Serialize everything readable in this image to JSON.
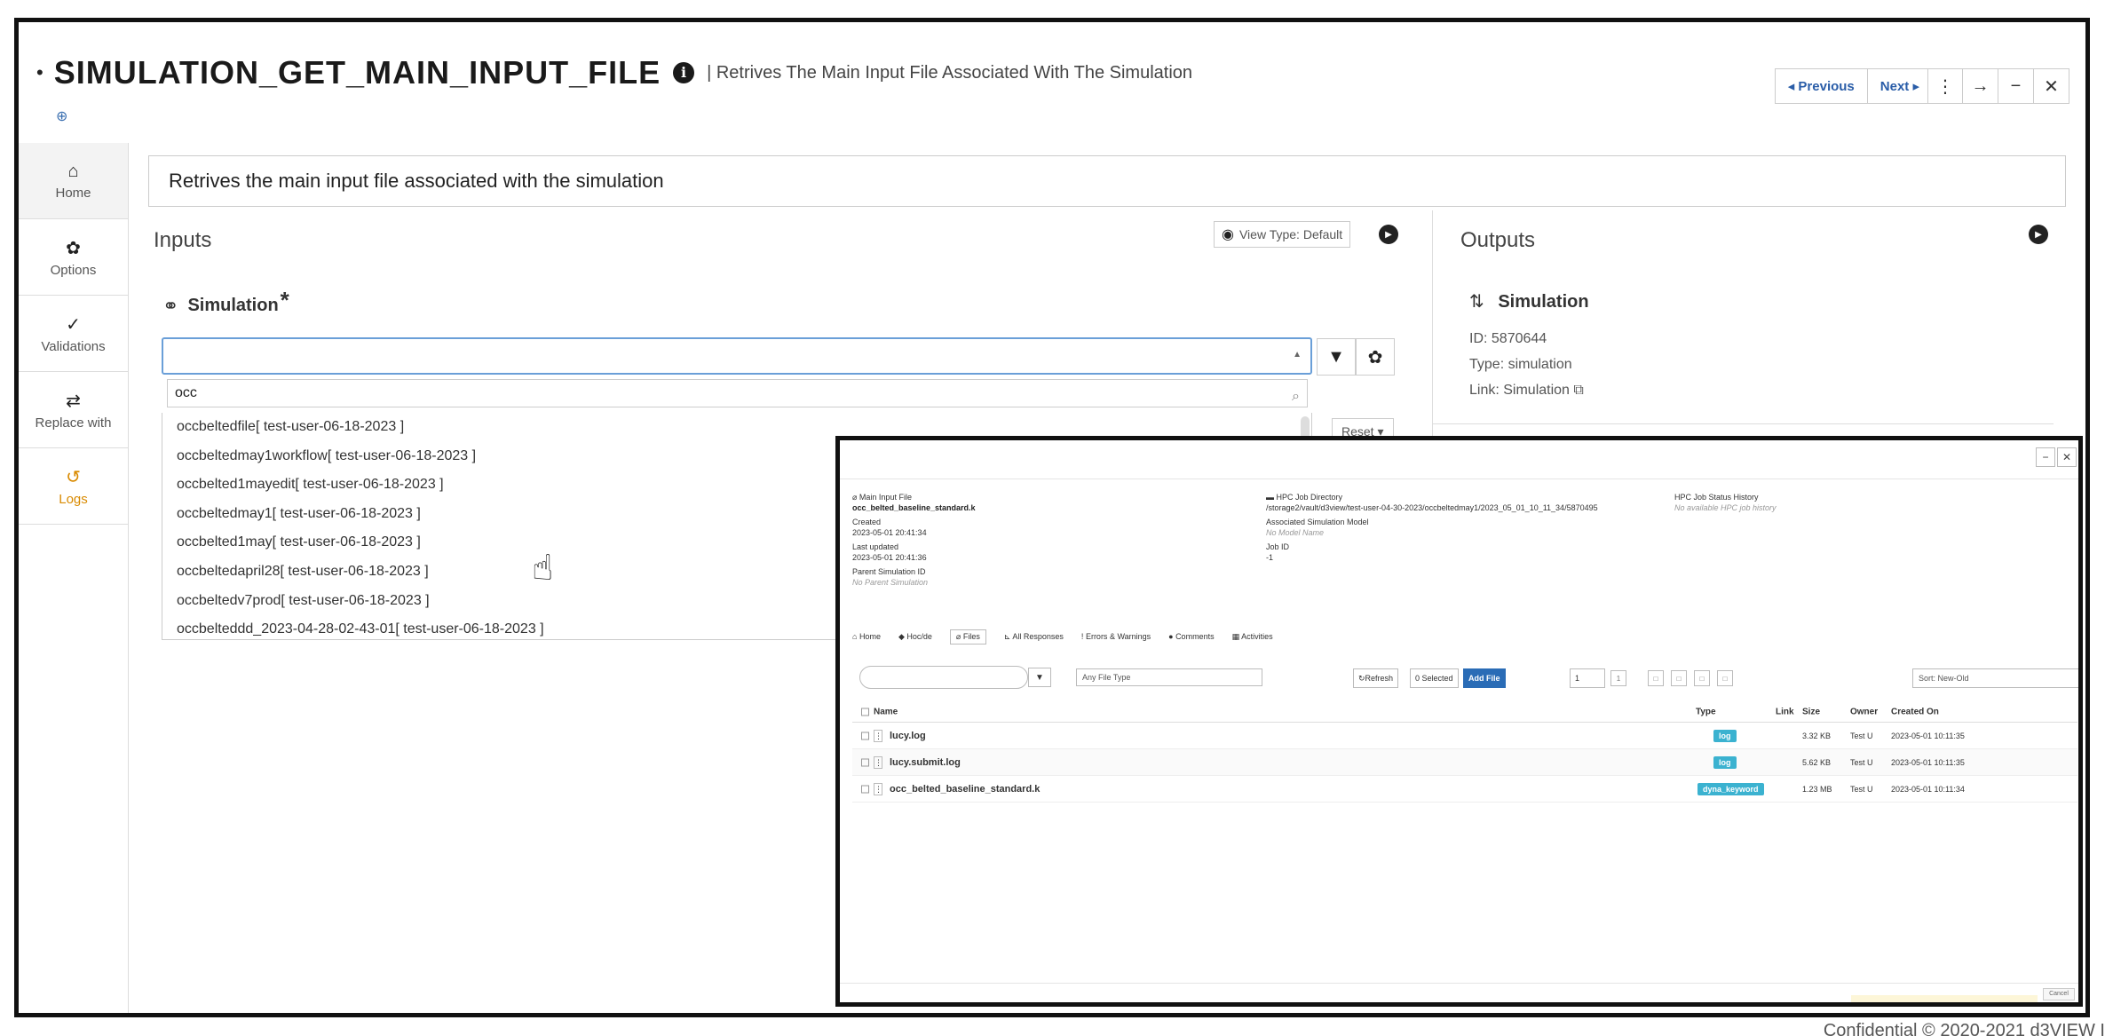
{
  "header": {
    "title": "SIMULATION_GET_MAIN_INPUT_FILE",
    "subtitle": "| Retrives The Main Input File Associated With The Simulation",
    "previous_label": "◂ Previous",
    "next_label": "Next ▸"
  },
  "sidebar": {
    "items": [
      {
        "label": "Home",
        "icon": "home-icon"
      },
      {
        "label": "Options",
        "icon": "gear-icon"
      },
      {
        "label": "Validations",
        "icon": "check-icon"
      },
      {
        "label": "Replace with",
        "icon": "swap-icon"
      },
      {
        "label": "Logs",
        "icon": "history-icon"
      }
    ]
  },
  "description": "Retrives the main input file associated with the simulation",
  "inputs": {
    "heading": "Inputs",
    "view_type": "View Type: Default",
    "simulation_label": "Simulation",
    "required_mark": "*",
    "search_value": "occ",
    "reset_label": "Reset ▾",
    "options": [
      "occbeltedfile[ test-user-06-18-2023 ]",
      "occbeltedmay1workflow[ test-user-06-18-2023 ]",
      "occbelted1mayedit[ test-user-06-18-2023 ]",
      "occbeltedmay1[ test-user-06-18-2023 ]",
      "occbelted1may[ test-user-06-18-2023 ]",
      "occbeltedapril28[ test-user-06-18-2023 ]",
      "occbeltedv7prod[ test-user-06-18-2023 ]",
      "occbelteddd_2023-04-28-02-43-01[ test-user-06-18-2023 ]"
    ]
  },
  "outputs": {
    "heading": "Outputs",
    "simulation_title": "Simulation",
    "id_line": "ID: 5870644",
    "type_line": "Type: simulation",
    "link_line": "Link: Simulation"
  },
  "overlay": {
    "meta": {
      "main_input_label": "Main Input File",
      "main_input_value": "occ_belted_baseline_standard.k",
      "created_label": "Created",
      "created_value": "2023-05-01 20:41:34",
      "updated_label": "Last updated",
      "updated_value": "2023-05-01 20:41:36",
      "parent_label": "Parent Simulation ID",
      "parent_value": "No Parent Simulation",
      "hpc_dir_label": "HPC Job Directory",
      "hpc_dir_value": "/storage2/vault/d3view/test-user-04-30-2023/occbeltedmay1/2023_05_01_10_11_34/5870495",
      "assoc_label": "Associated Simulation Model",
      "assoc_value": "No Model Name",
      "jobid_label": "Job ID",
      "jobid_value": "-1",
      "hpc_hist_label": "HPC Job Status History",
      "hpc_hist_value": "No available HPC job history"
    },
    "tabs": [
      "Home",
      "Hoc/de",
      "Files",
      "All Responses",
      "Errors & Warnings",
      "Comments",
      "Activities"
    ],
    "toolbar": {
      "file_type": "Any File Type",
      "refresh": "Refresh",
      "selected": "0 Selected",
      "add_file": "Add File",
      "page": "1",
      "sort": "Sort: New-Old"
    },
    "table": {
      "headers": [
        "Name",
        "Type",
        "Link",
        "Size",
        "Owner",
        "Created On"
      ],
      "rows": [
        {
          "name": "lucy.log",
          "type": "log",
          "size": "3.32 KB",
          "owner": "Test U",
          "created": "2023-05-01 10:11:35"
        },
        {
          "name": "lucy.submit.log",
          "type": "log",
          "size": "5.62 KB",
          "owner": "Test U",
          "created": "2023-05-01 10:11:35"
        },
        {
          "name": "occ_belted_baseline_standard.k",
          "type": "dyna_keyword",
          "size": "1.23 MB",
          "owner": "Test U",
          "created": "2023-05-01 10:11:34"
        }
      ]
    },
    "cancel_label": "Cancel"
  },
  "footer": "Confidential © 2020-2021 d3VIEW I"
}
